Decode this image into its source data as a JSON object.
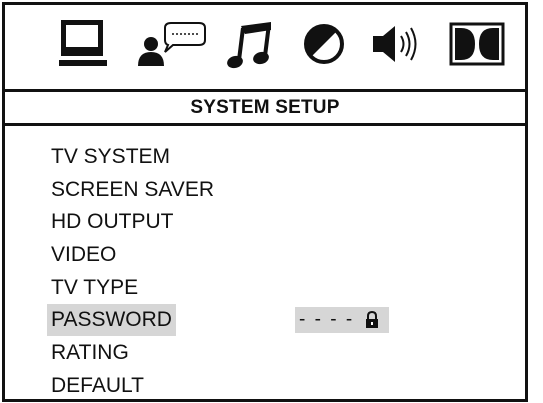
{
  "header": {
    "title": "SYSTEM SETUP"
  },
  "icon_tabs": [
    "monitor-icon",
    "speech-person-icon",
    "music-note-icon",
    "contrast-icon",
    "speaker-icon",
    "dolby-icon"
  ],
  "menu": {
    "items": [
      {
        "label": "TV SYSTEM"
      },
      {
        "label": "SCREEN SAVER"
      },
      {
        "label": "HD OUTPUT"
      },
      {
        "label": "VIDEO"
      },
      {
        "label": "TV TYPE"
      },
      {
        "label": "PASSWORD",
        "selected": true
      },
      {
        "label": "RATING"
      },
      {
        "label": "DEFAULT"
      }
    ]
  },
  "password": {
    "value": "- - - -",
    "icon": "lock-icon"
  },
  "colors": {
    "highlight": "#d6d6d6",
    "foreground": "#111111"
  }
}
